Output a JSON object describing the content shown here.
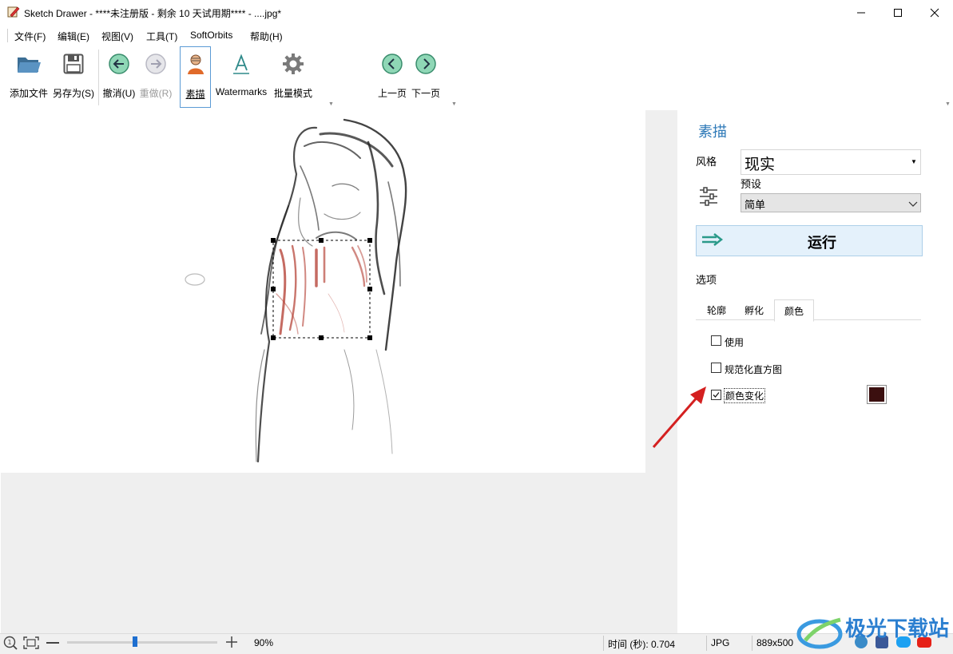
{
  "window": {
    "title": "Sketch Drawer - ****未注册版 - 剩余 10 天试用期**** - ....jpg*"
  },
  "menu": [
    "文件(F)",
    "编辑(E)",
    "视图(V)",
    "工具(T)",
    "SoftOrbits",
    "帮助(H)"
  ],
  "toolbar": {
    "add_file": "添加文件",
    "save_as": "另存为(S)",
    "undo": "撤消(U)",
    "redo": "重做(R)",
    "sketch": "素描",
    "watermarks": "Watermarks",
    "batch": "批量模式",
    "prev_page": "上一页",
    "next_page": "下一页"
  },
  "panel": {
    "title": "素描",
    "style_label": "风格",
    "style_value": "现实",
    "preset_label": "预设",
    "preset_value": "简单",
    "run_label": "运行",
    "options_label": "选项",
    "tabs": [
      "轮廓",
      "孵化",
      "颜色"
    ],
    "active_tab": "颜色",
    "options": [
      {
        "label": "使用",
        "checked": false
      },
      {
        "label": "规范化直方图",
        "checked": false
      },
      {
        "label": "颜色变化",
        "checked": true
      }
    ],
    "swatch_color": "#3b0f0f"
  },
  "status": {
    "zoom": "90%",
    "zoom_fraction": 0.45,
    "time": "时间 (秒): 0.704",
    "format": "JPG",
    "dimensions": "889x500"
  },
  "watermark_text": "极光下载站",
  "colors": {
    "accent": "#2f7ab8",
    "selection_red": "#b23a2e",
    "annotation_arrow": "#d42020"
  }
}
